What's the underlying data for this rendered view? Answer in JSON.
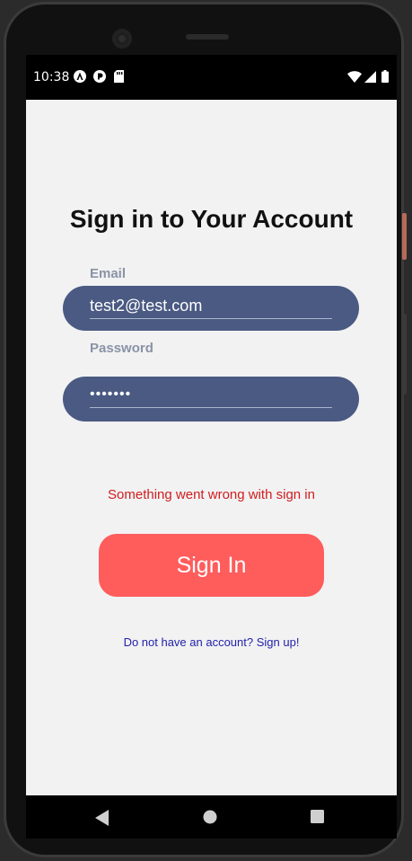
{
  "status_bar": {
    "time": "10:38",
    "icons": [
      "a11y-icon",
      "play-protect-icon",
      "sd-card-icon",
      "wifi-icon",
      "signal-icon",
      "battery-icon"
    ]
  },
  "signin": {
    "title": "Sign in to Your Account",
    "email_label": "Email",
    "email_value": "test2@test.com",
    "password_label": "Password",
    "password_value": "•••••••",
    "error_message": "Something went wrong with sign in",
    "button_label": "Sign In",
    "signup_link": "Do not have an account? Sign up!"
  },
  "colors": {
    "field_bg": "#4a5a82",
    "button_bg": "#ff5c5c",
    "error": "#d01e1e",
    "link": "#2222aa",
    "label": "#8a93a6"
  },
  "nav_bar": {
    "buttons": [
      "back-icon",
      "home-icon",
      "recents-icon"
    ]
  }
}
